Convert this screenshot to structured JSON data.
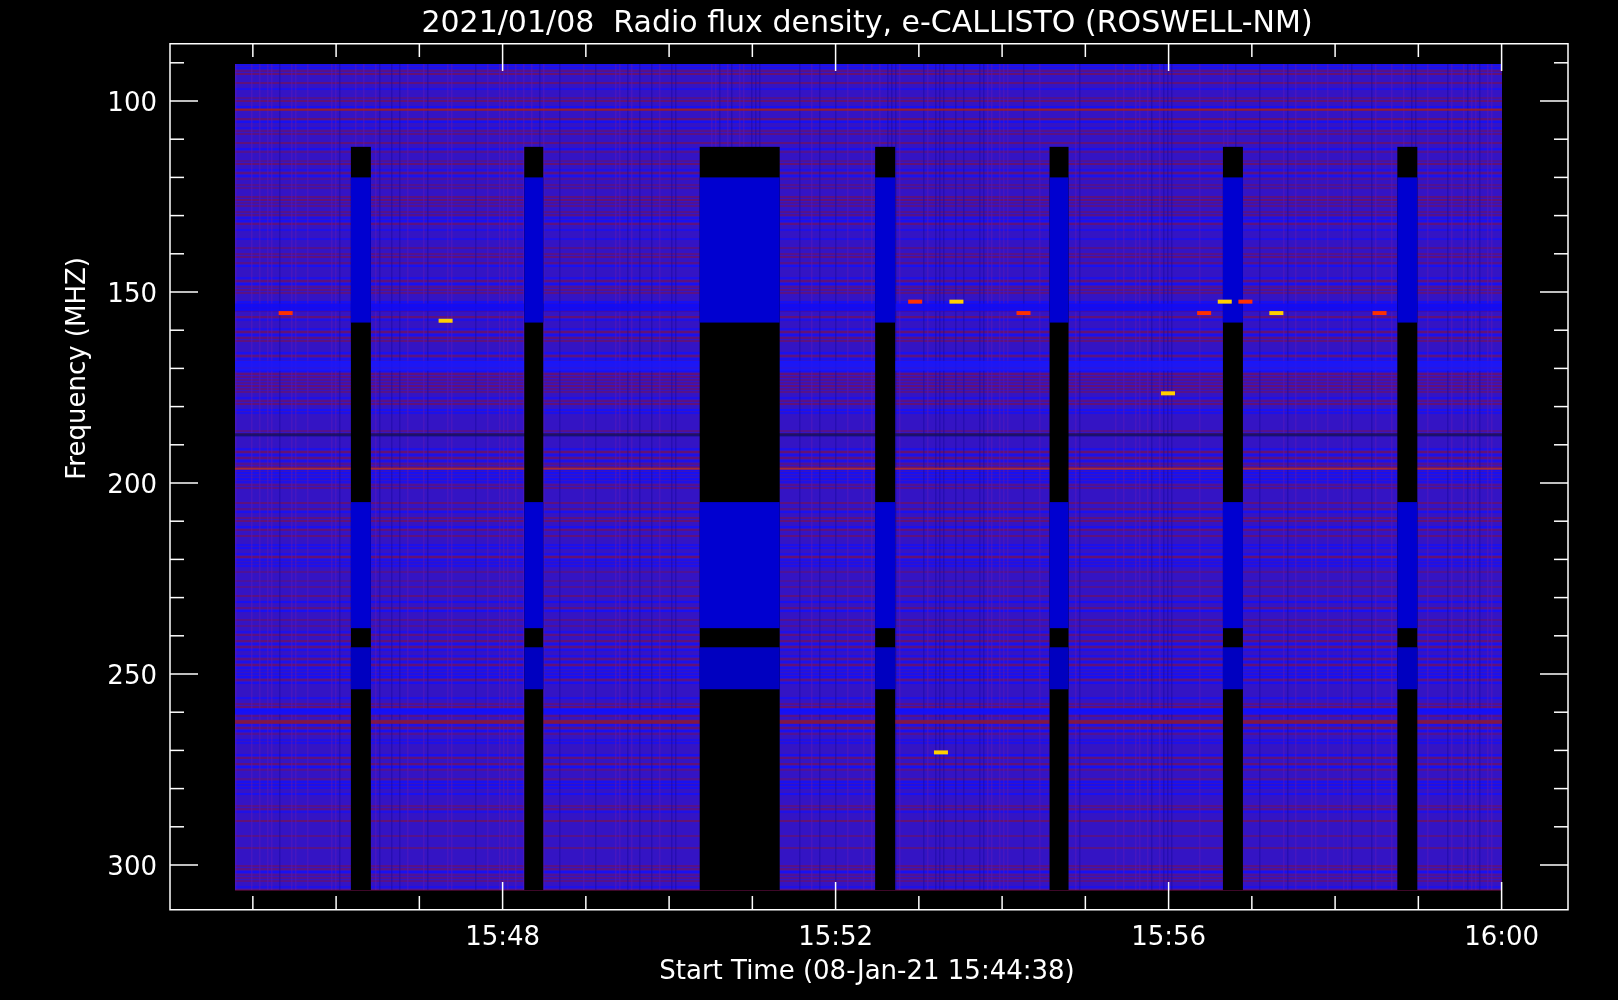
{
  "title": "2021/01/08  Radio flux density, e-CALLISTO (ROSWELL-NM)",
  "y_axis": {
    "label": "Frequency (MHZ)",
    "ticks": [
      "100",
      "150",
      "200",
      "250",
      "300"
    ]
  },
  "x_axis": {
    "label": "Start Time (08-Jan-21 15:44:38)",
    "ticks": [
      "15:48",
      "15:52",
      "15:56",
      "16:00"
    ]
  }
}
